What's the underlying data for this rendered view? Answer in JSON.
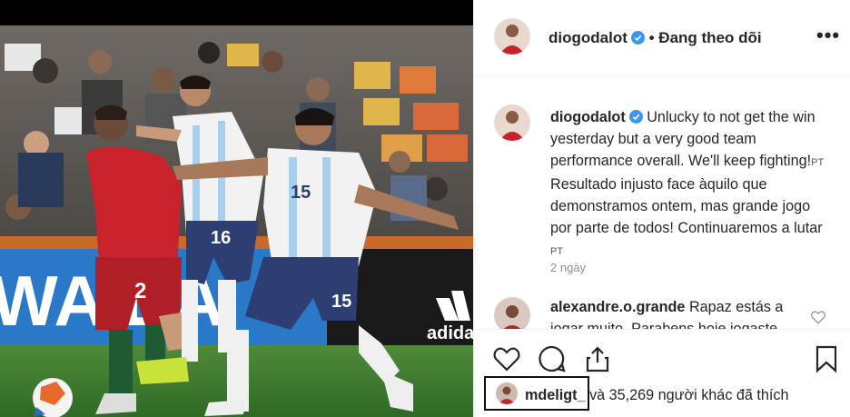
{
  "post": {
    "username": "diogodalot",
    "follow_status": "Đang theo dõi",
    "more_icon": "•••",
    "caption_text": "Unlucky to not get the win yesterday but a very good team performance overall. We'll keep fighting!",
    "caption_flag1": "PT",
    "caption_text_pt": " Resultado injusto face àquilo que demonstramos ontem, mas grande jogo por parte de todos! Continuaremos a lutar",
    "caption_flag2": "PT",
    "time_ago": "2 ngày"
  },
  "comment": {
    "username": "alexandre.o.grande",
    "text": "Rapaz estás a",
    "text_line2": "jogar muito. Parabens hoje jogaste"
  },
  "likes": {
    "first_user": "mdeligt_",
    "rest": "và 35,269 người khác đã thích"
  },
  "photo": {
    "player_number_left": "2",
    "player_number_mid": "16",
    "player_number_right": "15",
    "banner_text": "WA  DA",
    "adidas_text": "adidas"
  },
  "colors": {
    "verified_blue": "#3897f0",
    "portugal_red": "#c8232c",
    "argentina_blue": "#2c3e72"
  },
  "icons": {
    "like": "heart-icon",
    "comment": "comment-icon",
    "share": "share-icon",
    "save": "bookmark-icon"
  }
}
